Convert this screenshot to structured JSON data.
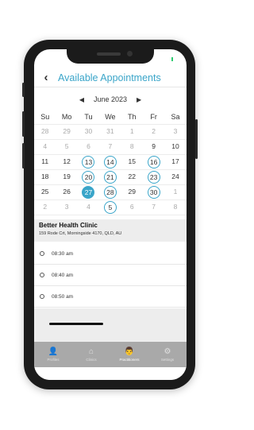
{
  "header": {
    "back_label": "‹",
    "title": "Available Appointments"
  },
  "calendar": {
    "month_label": "June 2023",
    "prev_label": "◀",
    "next_label": "▶",
    "weekdays": [
      "Su",
      "Mo",
      "Tu",
      "We",
      "Th",
      "Fr",
      "Sa"
    ],
    "weeks": [
      [
        {
          "d": "28",
          "s": "muted"
        },
        {
          "d": "29",
          "s": "muted"
        },
        {
          "d": "30",
          "s": "muted"
        },
        {
          "d": "31",
          "s": "muted"
        },
        {
          "d": "1",
          "s": "muted"
        },
        {
          "d": "2",
          "s": "muted"
        },
        {
          "d": "3",
          "s": "muted"
        }
      ],
      [
        {
          "d": "4",
          "s": "muted"
        },
        {
          "d": "5",
          "s": "muted"
        },
        {
          "d": "6",
          "s": "muted"
        },
        {
          "d": "7",
          "s": "muted"
        },
        {
          "d": "8",
          "s": "muted"
        },
        {
          "d": "9",
          "s": "norm"
        },
        {
          "d": "10",
          "s": "norm"
        }
      ],
      [
        {
          "d": "11",
          "s": "norm"
        },
        {
          "d": "12",
          "s": "norm"
        },
        {
          "d": "13",
          "s": "avail"
        },
        {
          "d": "14",
          "s": "avail"
        },
        {
          "d": "15",
          "s": "norm"
        },
        {
          "d": "16",
          "s": "avail"
        },
        {
          "d": "17",
          "s": "norm"
        }
      ],
      [
        {
          "d": "18",
          "s": "norm"
        },
        {
          "d": "19",
          "s": "norm"
        },
        {
          "d": "20",
          "s": "avail"
        },
        {
          "d": "21",
          "s": "avail"
        },
        {
          "d": "22",
          "s": "norm"
        },
        {
          "d": "23",
          "s": "avail"
        },
        {
          "d": "24",
          "s": "norm"
        }
      ],
      [
        {
          "d": "25",
          "s": "norm"
        },
        {
          "d": "26",
          "s": "norm"
        },
        {
          "d": "27",
          "s": "sel"
        },
        {
          "d": "28",
          "s": "avail"
        },
        {
          "d": "29",
          "s": "norm"
        },
        {
          "d": "30",
          "s": "avail"
        },
        {
          "d": "1",
          "s": "muted"
        }
      ],
      [
        {
          "d": "2",
          "s": "muted"
        },
        {
          "d": "3",
          "s": "muted"
        },
        {
          "d": "4",
          "s": "muted"
        },
        {
          "d": "5",
          "s": "avail-muted"
        },
        {
          "d": "6",
          "s": "muted"
        },
        {
          "d": "7",
          "s": "muted"
        },
        {
          "d": "8",
          "s": "muted"
        }
      ]
    ]
  },
  "clinic": {
    "name": "Better Health Clinic",
    "address": "159 Rode Crt, Morningside 4170, QLD, AU"
  },
  "slots": [
    "08:30 am",
    "08:40 am",
    "08:50 am"
  ],
  "tabs": [
    {
      "label": "Profiles",
      "icon": "person-icon",
      "glyph": "👤",
      "active": false
    },
    {
      "label": "Clinics",
      "icon": "home-icon",
      "glyph": "⌂",
      "active": false
    },
    {
      "label": "Practitioners",
      "icon": "doctor-icon",
      "glyph": "👨",
      "active": true
    },
    {
      "label": "Settings",
      "icon": "gear-icon",
      "glyph": "⚙",
      "active": false
    }
  ],
  "colors": {
    "accent": "#3aa5c9",
    "tabbar": "#a9a9a9",
    "clinic_bg": "#ededed"
  }
}
